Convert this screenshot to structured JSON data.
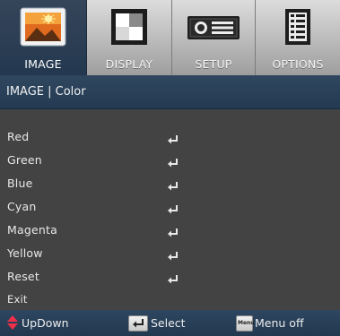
{
  "tabs": [
    {
      "label": "IMAGE",
      "icon": "image-picture-icon",
      "active": true
    },
    {
      "label": "DISPLAY",
      "icon": "display-grid-icon",
      "active": false
    },
    {
      "label": "SETUP",
      "icon": "projector-icon",
      "active": false
    },
    {
      "label": "OPTIONS",
      "icon": "options-list-icon",
      "active": false
    }
  ],
  "breadcrumb": "IMAGE | Color",
  "menu": [
    {
      "label": "Red",
      "enter_icon": true
    },
    {
      "label": "Green",
      "enter_icon": true
    },
    {
      "label": "Blue",
      "enter_icon": true
    },
    {
      "label": "Cyan",
      "enter_icon": true
    },
    {
      "label": "Magenta",
      "enter_icon": true
    },
    {
      "label": "Yellow",
      "enter_icon": true
    },
    {
      "label": "Reset",
      "enter_icon": true
    },
    {
      "label": "Exit",
      "enter_icon": false
    }
  ],
  "footer": {
    "updown_label": "UpDown",
    "select_label": "Select",
    "menu_key_label": "Menu",
    "menuoff_label": "Menu off"
  },
  "colors": {
    "accent": "#f0304a",
    "header_blue": "#2a4058"
  }
}
